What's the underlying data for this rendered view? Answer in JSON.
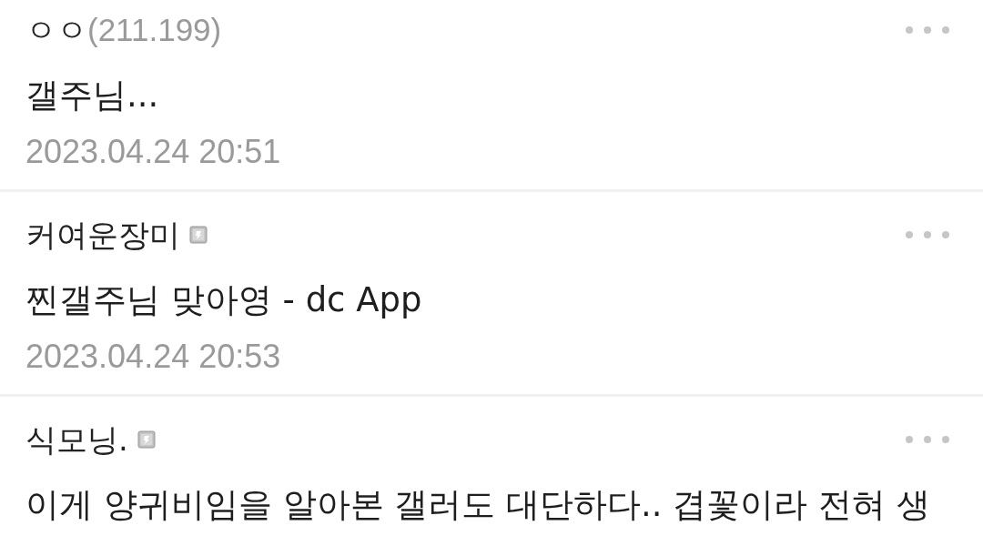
{
  "comments": [
    {
      "author": "ㅇㅇ",
      "ip": "(211.199)",
      "member_badge": false,
      "content": "갤주님...",
      "date": "2023.04.24 20:51"
    },
    {
      "author": "커여운장미",
      "member_badge": true,
      "content": "찐갤주님 맞아영 - dc App",
      "date": "2023.04.24 20:53"
    },
    {
      "author": "식모닝.",
      "member_badge": true,
      "content": "이게 양귀비임을 알아본 갤러도 대단하다.. 겹꽃이라 전혀 생"
    }
  ]
}
